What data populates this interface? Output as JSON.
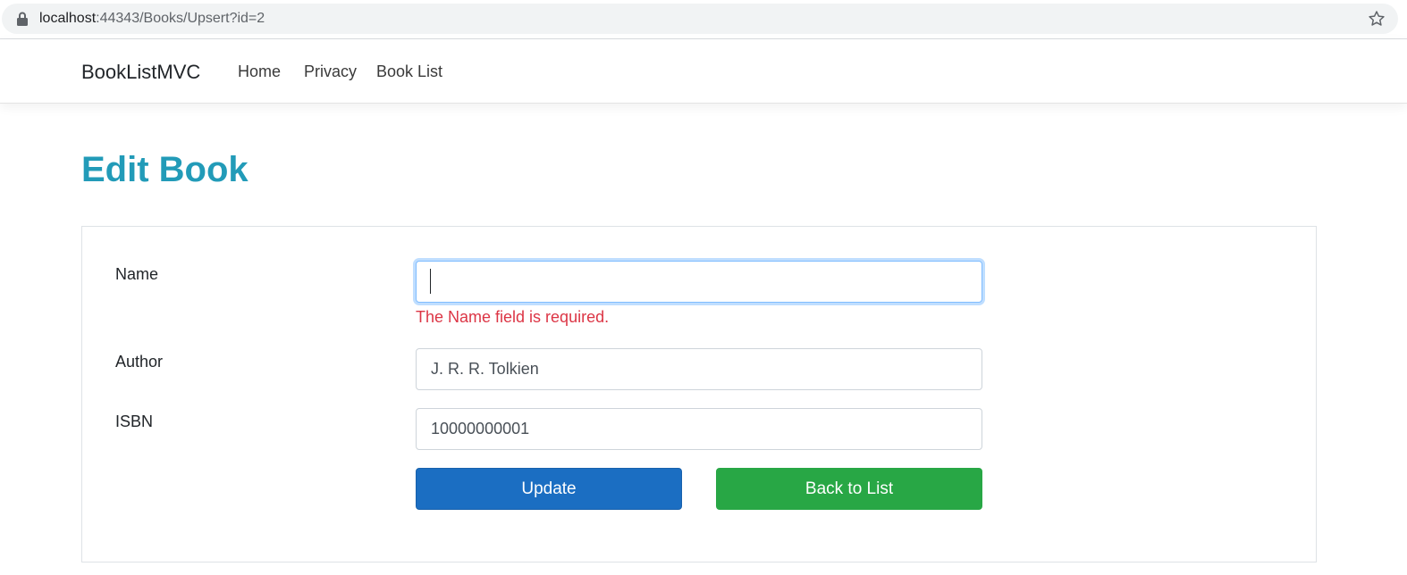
{
  "browser": {
    "url_host": "localhost",
    "url_path": ":44343/Books/Upsert?id=2",
    "icons": {
      "lock": "lock-icon",
      "star": "bookmark-star-icon"
    }
  },
  "navbar": {
    "brand": "BookListMVC",
    "links": [
      "Home",
      "Privacy",
      "Book List"
    ]
  },
  "page": {
    "title": "Edit Book"
  },
  "form": {
    "name": {
      "label": "Name",
      "value": "",
      "validation": "The Name field is required."
    },
    "author": {
      "label": "Author",
      "value": "J. R. R. Tolkien"
    },
    "isbn": {
      "label": "ISBN",
      "value": "10000000001"
    },
    "buttons": {
      "update": "Update",
      "back": "Back to List"
    }
  },
  "colors": {
    "title": "#229bb8",
    "update_button": "#1b6ec2",
    "back_button": "#28a745",
    "error": "#dc3545"
  }
}
